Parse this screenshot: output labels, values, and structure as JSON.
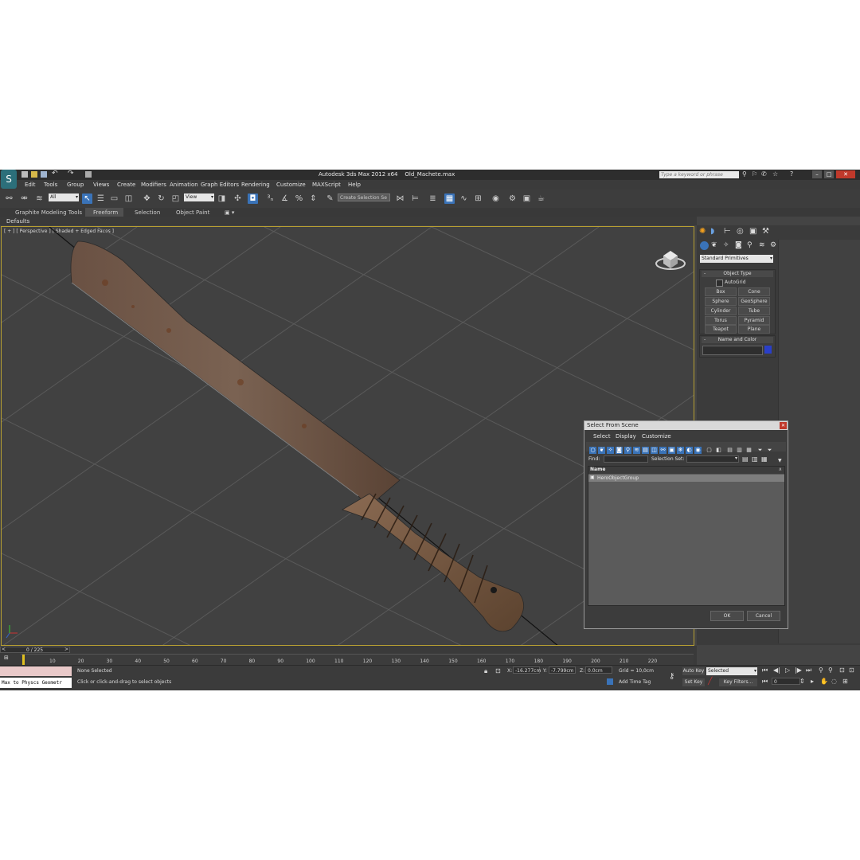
{
  "window": {
    "title": "Autodesk 3ds Max  2012 x64",
    "filename": "Old_Machete.max",
    "search_placeholder": "Type a keyword or phrase"
  },
  "menu": {
    "items": [
      "Edit",
      "Tools",
      "Group",
      "Views",
      "Create",
      "Modifiers",
      "Animation",
      "Graph Editors",
      "Rendering",
      "Customize",
      "MAXScript",
      "Help"
    ]
  },
  "toolbar": {
    "selection_filter": "All",
    "reference_coord": "View",
    "named_selection_placeholder": "Create Selection Se"
  },
  "ribbon": {
    "tabs": [
      "Graphite Modeling Tools",
      "Freeform",
      "Selection",
      "Object Paint"
    ],
    "subpanel": "Defaults"
  },
  "viewport": {
    "label": "[ + ] [ Perspective ] [ Shaded + Edged Faces ]"
  },
  "command_panel": {
    "dropdown": "Standard Primitives",
    "object_type_title": "Object Type",
    "autogrid_label": "AutoGrid",
    "buttons": [
      "Box",
      "Cone",
      "Sphere",
      "GeoSphere",
      "Cylinder",
      "Tube",
      "Torus",
      "Pyramid",
      "Teapot",
      "Plane"
    ],
    "name_color_title": "Name and Color",
    "swatch_color": "#2a3fc8"
  },
  "dialog": {
    "title": "Select From Scene",
    "menu": [
      "Select",
      "Display",
      "Customize"
    ],
    "find_label": "Find:",
    "selection_set_label": "Selection Set:",
    "column_header": "Name",
    "rows": [
      "HeroObjectGroup"
    ],
    "ok_label": "OK",
    "cancel_label": "Cancel"
  },
  "timeline": {
    "frame_counter": "0 / 225",
    "ticks": [
      "10",
      "20",
      "30",
      "40",
      "50",
      "60",
      "70",
      "80",
      "90",
      "100",
      "110",
      "120",
      "130",
      "140",
      "150",
      "160",
      "170",
      "180",
      "190",
      "200",
      "210",
      "220"
    ]
  },
  "status": {
    "maxscript_listener": "Max to Physcs Geometr",
    "selection_status": "None Selected",
    "prompt": "Click or click-and-drag to select objects",
    "x_label": "X:",
    "x_value": "-16.277cm",
    "y_label": "Y:",
    "y_value": "-7.799cm",
    "z_label": "Z:",
    "z_value": "0.0cm",
    "grid": "Grid = 10,0cm",
    "add_time_tag": "Add Time Tag",
    "auto_key": "Auto Key",
    "set_key": "Set Key",
    "key_mode": "Selected",
    "key_filters": "Key Filters...",
    "frame_value": "0"
  }
}
